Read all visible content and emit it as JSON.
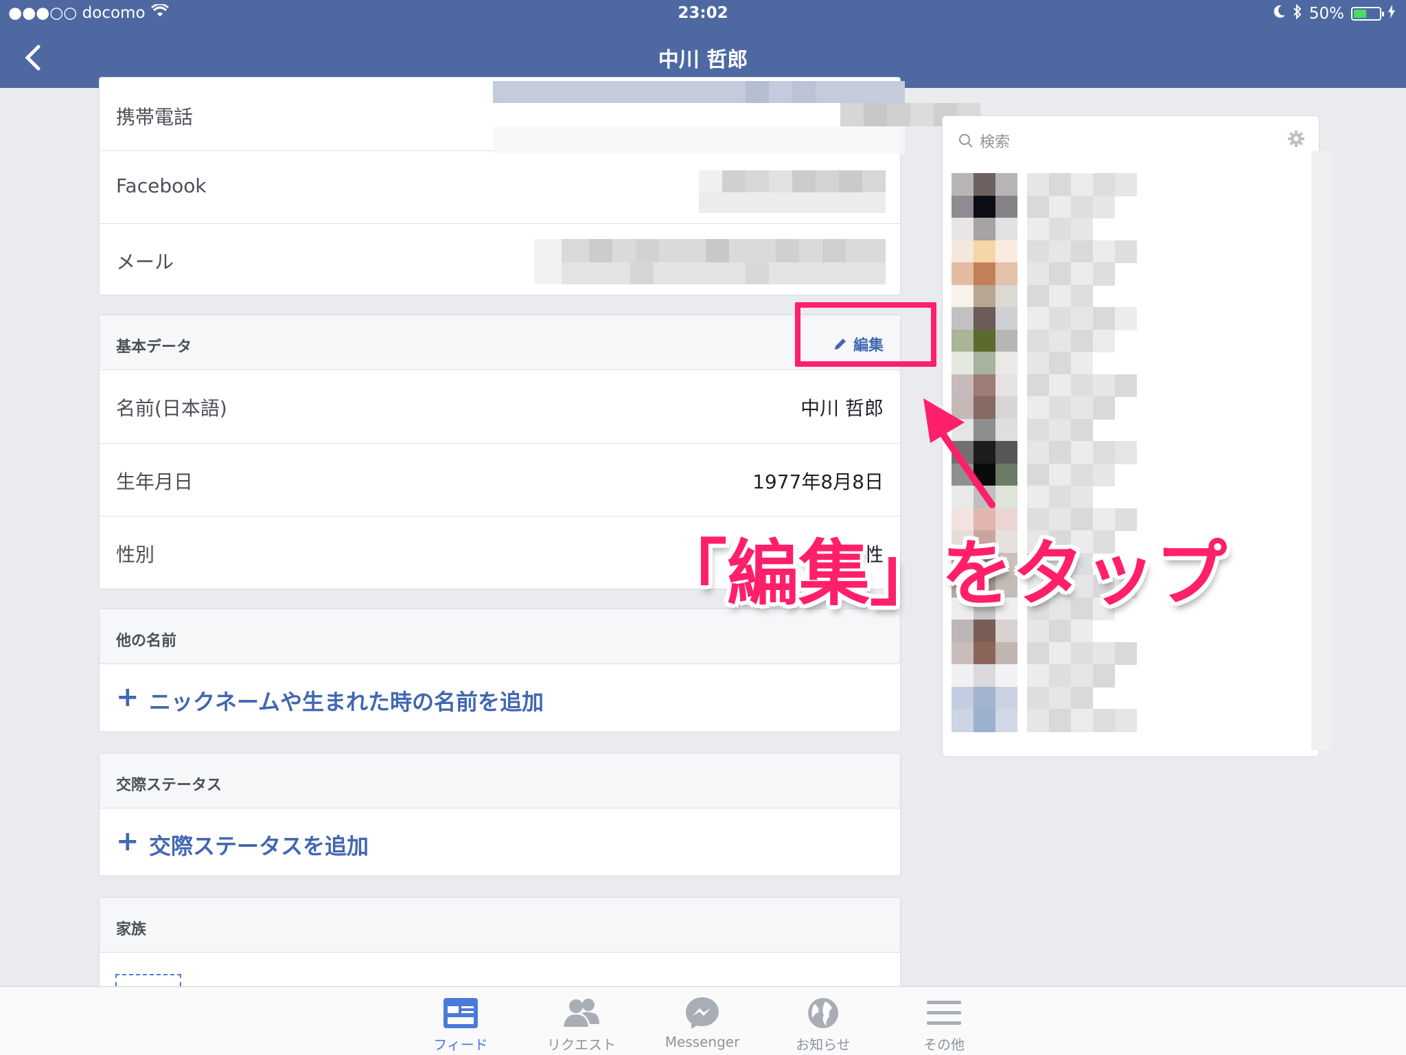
{
  "status_bar": {
    "carrier": "●●●○○ docomo",
    "time": "23:02",
    "battery": "50%",
    "battery_level": 0.5
  },
  "nav": {
    "title": "中川 哲郎"
  },
  "contact": {
    "rows": [
      {
        "label": "携帯電話"
      },
      {
        "label": "Facebook"
      },
      {
        "label": "メール"
      }
    ]
  },
  "basic": {
    "header": "基本データ",
    "edit_label": "編集",
    "rows": [
      {
        "label": "名前(日本語)",
        "value": "中川 哲郎"
      },
      {
        "label": "生年月日",
        "value": "1977年8月8日"
      },
      {
        "label": "性別",
        "value": "男性"
      }
    ]
  },
  "other_names": {
    "header": "他の名前",
    "add_label": "ニックネームや生まれた時の名前を追加"
  },
  "relationship": {
    "header": "交際ステータス",
    "add_label": "交際ステータスを追加"
  },
  "family": {
    "header": "家族"
  },
  "right_panel": {
    "search_placeholder": "検索"
  },
  "annotation": {
    "callout": "「編集」をタップ",
    "color": "#ff1f6b"
  },
  "tabs": [
    {
      "label": "フィード",
      "icon": "feed-icon",
      "active": true
    },
    {
      "label": "リクエスト",
      "icon": "friend-requests-icon",
      "active": false
    },
    {
      "label": "Messenger",
      "icon": "messenger-icon",
      "active": false
    },
    {
      "label": "お知らせ",
      "icon": "globe-icon",
      "active": false
    },
    {
      "label": "その他",
      "icon": "menu-icon",
      "active": false
    }
  ],
  "colors": {
    "header_blue": "#4e69a2",
    "link_blue": "#4267b2",
    "annotation_pink": "#ff1f6b"
  }
}
